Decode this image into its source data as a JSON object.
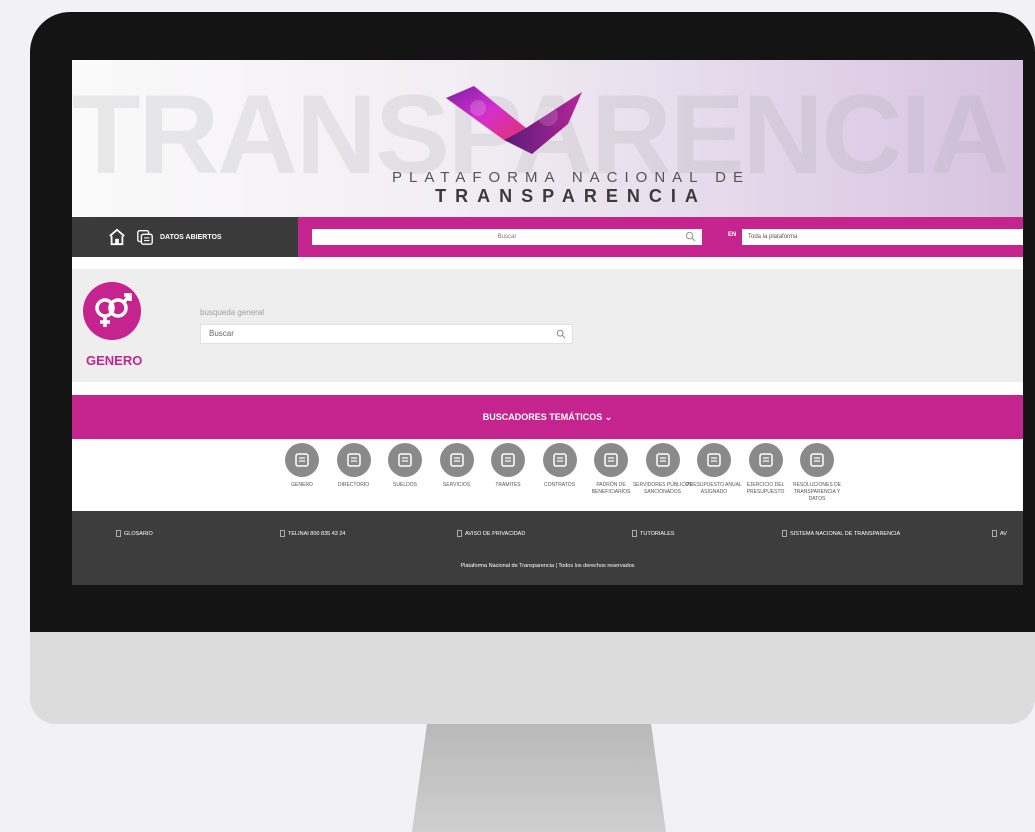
{
  "colors": {
    "brand_magenta": "#c5238d",
    "nav_dark": "#3a3a3a",
    "footer_dark": "#3d3d3d",
    "icon_gray": "#8a8a8a"
  },
  "hero": {
    "background_word": "TRANSPARENCIA",
    "subtitle": "PLATAFORMA NACIONAL DE",
    "title": "TRANSPARENCIA"
  },
  "navbar": {
    "home_icon": "home-icon",
    "data_icon": "open-data-icon",
    "datos_abiertos_label": "DATOS ABIERTOS",
    "search_placeholder": "Buscar",
    "scope_prefix": "EN",
    "scope_value": "Toda la plataforma"
  },
  "genero": {
    "icon": "gender-icon",
    "label": "GENERO",
    "search_label": "busqueda general",
    "search_placeholder": "Buscar"
  },
  "thematic": {
    "heading": "BUSCADORES TEMÁTICOS ⌄",
    "items": [
      {
        "label": "GENERO",
        "icon": "gender-icon"
      },
      {
        "label": "DIRECTORIO",
        "icon": "directory-icon"
      },
      {
        "label": "SUELDOS",
        "icon": "salary-icon"
      },
      {
        "label": "SERVICIOS",
        "icon": "services-icon"
      },
      {
        "label": "TRÁMITES",
        "icon": "procedures-icon"
      },
      {
        "label": "CONTRATOS",
        "icon": "contracts-icon"
      },
      {
        "label": "PADRÓN DE BENEFICIARIOS",
        "icon": "beneficiaries-icon"
      },
      {
        "label": "SERVIDORES PÚBLICOS SANCIONADOS",
        "icon": "sanctioned-servants-icon"
      },
      {
        "label": "PRESUPUESTO ANUAL ASIGNADO",
        "icon": "budget-icon"
      },
      {
        "label": "EJERCICIO DEL PRESUPUESTO",
        "icon": "budget-execution-icon"
      },
      {
        "label": "RESOLUCIONES DE TRANSPARENCIA Y DATOS",
        "icon": "resolutions-icon"
      }
    ]
  },
  "footer": {
    "links": [
      {
        "label": "GLOSARIO",
        "icon": "glossary-icon"
      },
      {
        "label": "TELINAI 800 835 43 24",
        "icon": "phone-icon"
      },
      {
        "label": "AVISO DE PRIVACIDAD",
        "icon": "privacy-icon"
      },
      {
        "label": "TUTORIALES",
        "icon": "tutorials-icon"
      },
      {
        "label": "SISTEMA NACIONAL DE TRANSPARENCIA",
        "icon": "system-icon"
      },
      {
        "label": "AV",
        "icon": "notice-icon"
      }
    ],
    "copyright": "Plataforma Nacional de Transparencia | Todos los derechos reservados"
  }
}
